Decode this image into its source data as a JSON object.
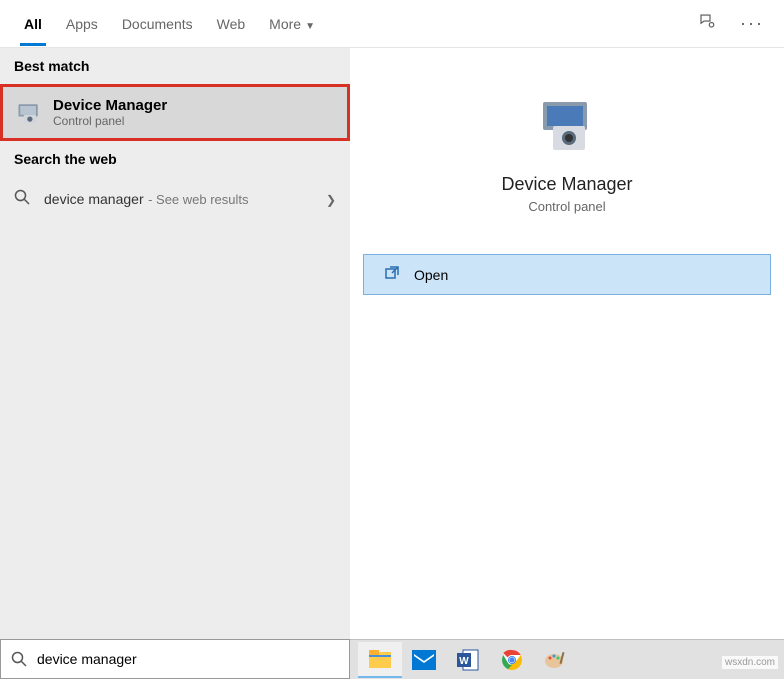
{
  "tabs": {
    "all": "All",
    "apps": "Apps",
    "documents": "Documents",
    "web": "Web",
    "more": "More"
  },
  "sections": {
    "best_match": "Best match",
    "search_web": "Search the web"
  },
  "result": {
    "title": "Device Manager",
    "subtitle": "Control panel"
  },
  "web_search": {
    "query": "device manager",
    "suffix": "- See web results"
  },
  "preview": {
    "title": "Device Manager",
    "subtitle": "Control panel",
    "open_label": "Open"
  },
  "search": {
    "value": "device manager"
  },
  "watermark": "wsxdn.com"
}
